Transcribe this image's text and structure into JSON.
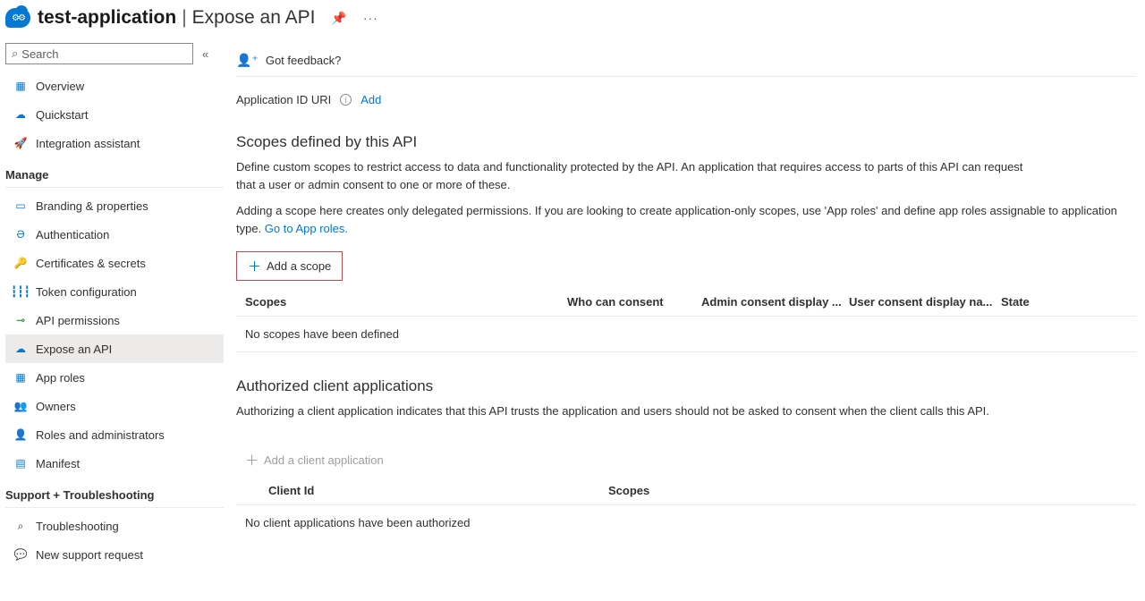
{
  "header": {
    "app_name": "test-application",
    "page_title": "Expose an API"
  },
  "search": {
    "placeholder": "Search"
  },
  "nav": {
    "top": [
      {
        "label": "Overview",
        "icon": "▦",
        "color": "#0078d4"
      },
      {
        "label": "Quickstart",
        "icon": "☁",
        "color": "#0078d4"
      },
      {
        "label": "Integration assistant",
        "icon": "🚀",
        "color": "#d83b01"
      }
    ],
    "manage_label": "Manage",
    "manage": [
      {
        "label": "Branding & properties",
        "icon": "▭",
        "color": "#0078d4"
      },
      {
        "label": "Authentication",
        "icon": "Ә",
        "color": "#0078d4"
      },
      {
        "label": "Certificates & secrets",
        "icon": "🔑",
        "color": "#d1a300"
      },
      {
        "label": "Token configuration",
        "icon": "┇┇┇",
        "color": "#0078d4"
      },
      {
        "label": "API permissions",
        "icon": "⊸",
        "color": "#107c10"
      },
      {
        "label": "Expose an API",
        "icon": "☁",
        "color": "#0078d4",
        "active": true
      },
      {
        "label": "App roles",
        "icon": "▦",
        "color": "#0078d4"
      },
      {
        "label": "Owners",
        "icon": "👥",
        "color": "#0078d4"
      },
      {
        "label": "Roles and administrators",
        "icon": "👤",
        "color": "#107c10"
      },
      {
        "label": "Manifest",
        "icon": "▤",
        "color": "#0078d4"
      }
    ],
    "support_label": "Support + Troubleshooting",
    "support": [
      {
        "label": "Troubleshooting",
        "icon": "⌕",
        "color": "#323130"
      },
      {
        "label": "New support request",
        "icon": "💬",
        "color": "#0078d4"
      }
    ]
  },
  "feedback": {
    "label": "Got feedback?"
  },
  "app_id": {
    "label": "Application ID URI",
    "action": "Add"
  },
  "scopes_section": {
    "title": "Scopes defined by this API",
    "desc1": "Define custom scopes to restrict access to data and functionality protected by the API. An application that requires access to parts of this API can request that a user or admin consent to one or more of these.",
    "desc2_a": "Adding a scope here creates only delegated permissions. If you are looking to create application-only scopes, use 'App roles' and define app roles assignable to application type. ",
    "desc2_link": "Go to App roles.",
    "add_button": "Add a scope",
    "columns": {
      "scopes": "Scopes",
      "who": "Who can consent",
      "admin": "Admin consent display ...",
      "user": "User consent display na...",
      "state": "State"
    },
    "empty": "No scopes have been defined"
  },
  "clients_section": {
    "title": "Authorized client applications",
    "desc": "Authorizing a client application indicates that this API trusts the application and users should not be asked to consent when the client calls this API.",
    "add_button": "Add a client application",
    "columns": {
      "client": "Client Id",
      "scopes": "Scopes"
    },
    "empty": "No client applications have been authorized"
  }
}
